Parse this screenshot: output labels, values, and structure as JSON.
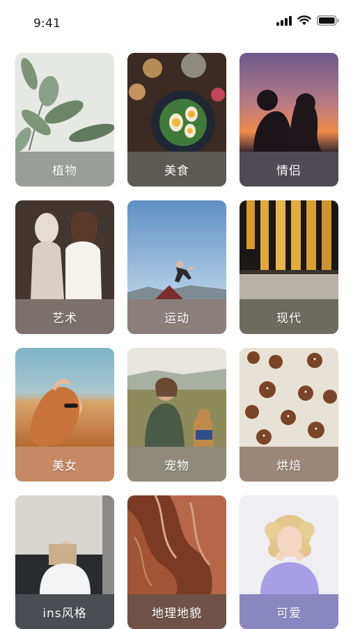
{
  "status_bar": {
    "time": "9:41",
    "icons": [
      "signal-icon",
      "wifi-icon",
      "battery-icon"
    ]
  },
  "categories": [
    {
      "label": "植物",
      "bar_color": "#9a9e99"
    },
    {
      "label": "美食",
      "bar_color": "#5b5a54"
    },
    {
      "label": "情侣",
      "bar_color": "#4f4b53"
    },
    {
      "label": "艺术",
      "bar_color": "#7b716c"
    },
    {
      "label": "运动",
      "bar_color": "#8a7f7b"
    },
    {
      "label": "现代",
      "bar_color": "#6d6a5f"
    },
    {
      "label": "美女",
      "bar_color": "#c58a63"
    },
    {
      "label": "宠物",
      "bar_color": "#8f8a7a"
    },
    {
      "label": "烘焙",
      "bar_color": "#9b8677"
    },
    {
      "label": "ins风格",
      "bar_color": "#4c4d52"
    },
    {
      "label": "地理地貌",
      "bar_color": "#6e5247"
    },
    {
      "label": "可爱",
      "bar_color": "#8a86c0"
    }
  ]
}
